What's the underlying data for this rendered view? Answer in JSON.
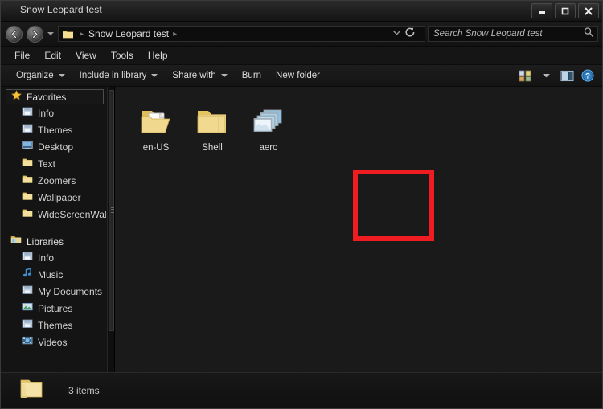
{
  "window": {
    "title": "Snow Leopard test",
    "controls": {
      "minimize": "Minimize",
      "maximize": "Maximize",
      "close": "Close"
    }
  },
  "address_bar": {
    "back": "Back",
    "forward": "Forward",
    "recent_pages": "Recent Pages",
    "breadcrumb": [
      "Snow Leopard test"
    ],
    "breadcrumb_separator": "▸",
    "previous_locations": "Previous Locations",
    "refresh": "Refresh",
    "search": {
      "placeholder": "Search Snow Leopard test",
      "value": "",
      "icon": "search-icon"
    }
  },
  "menu_bar": {
    "items": [
      {
        "label": "File"
      },
      {
        "label": "Edit"
      },
      {
        "label": "View"
      },
      {
        "label": "Tools"
      },
      {
        "label": "Help"
      }
    ]
  },
  "toolbar": {
    "items": [
      {
        "label": "Organize",
        "has_caret": true
      },
      {
        "label": "Include in library",
        "has_caret": true
      },
      {
        "label": "Share with",
        "has_caret": true
      },
      {
        "label": "Burn",
        "has_caret": false
      },
      {
        "label": "New folder",
        "has_caret": false
      }
    ],
    "right_icons": [
      {
        "name": "change-view-icon",
        "label": "Change your view"
      },
      {
        "name": "chevron-down-icon",
        "label": "More options"
      },
      {
        "name": "preview-pane-icon",
        "label": "Show the preview pane"
      },
      {
        "name": "help-icon",
        "label": "Get help"
      }
    ]
  },
  "sidebar": {
    "groups": [
      {
        "name": "Favorites",
        "icon": "star-icon",
        "selected": true,
        "items": [
          {
            "label": "Info",
            "icon": "folder-special-icon"
          },
          {
            "label": "Themes",
            "icon": "folder-special-icon"
          },
          {
            "label": "Desktop",
            "icon": "desktop-icon"
          },
          {
            "label": "Text",
            "icon": "folder-icon"
          },
          {
            "label": "Zoomers",
            "icon": "folder-icon"
          },
          {
            "label": "Wallpaper",
            "icon": "folder-icon"
          },
          {
            "label": "WideScreenWal",
            "icon": "folder-icon"
          }
        ]
      },
      {
        "name": "Libraries",
        "icon": "libraries-icon",
        "selected": false,
        "items": [
          {
            "label": "Info",
            "icon": "folder-special-icon"
          },
          {
            "label": "Music",
            "icon": "music-icon"
          },
          {
            "label": "My Documents",
            "icon": "folder-special-icon"
          },
          {
            "label": "Pictures",
            "icon": "pictures-icon"
          },
          {
            "label": "Themes",
            "icon": "folder-special-icon"
          },
          {
            "label": "Videos",
            "icon": "videos-icon"
          }
        ]
      }
    ]
  },
  "content": {
    "items": [
      {
        "label": "en-US",
        "icon": "folder-open-document-icon"
      },
      {
        "label": "Shell",
        "icon": "folder-icon"
      },
      {
        "label": "aero",
        "icon": "picture-stack-icon",
        "highlighted": true
      }
    ],
    "highlight_color": "#ef1c22"
  },
  "status_bar": {
    "icon": "folder-icon",
    "count_text": "3 items"
  }
}
